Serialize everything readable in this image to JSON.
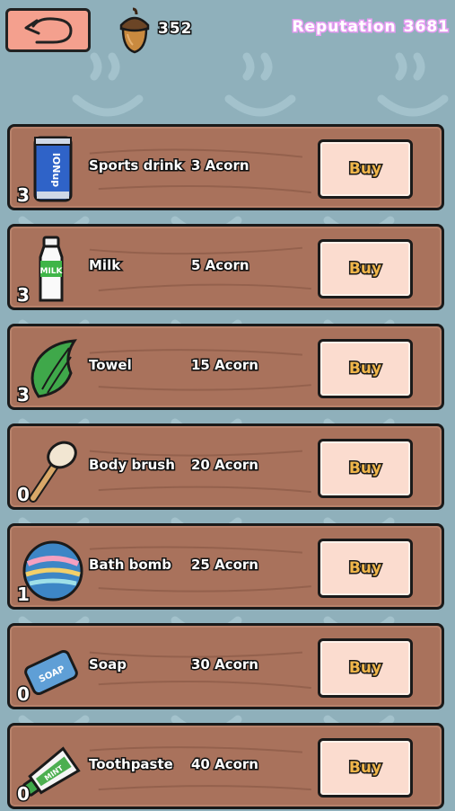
{
  "header": {
    "acorn_count": "352",
    "reputation_label": "Reputation",
    "reputation_value": "3681"
  },
  "items": [
    {
      "name": "Sports drink",
      "price": "3 Acorn",
      "count": "3",
      "buy_label": "Buy",
      "icon": "sports-drink-icon"
    },
    {
      "name": "Milk",
      "price": "5 Acorn",
      "count": "3",
      "buy_label": "Buy",
      "icon": "milk-bottle-icon"
    },
    {
      "name": "Towel",
      "price": "15 Acorn",
      "count": "3",
      "buy_label": "Buy",
      "icon": "towel-icon"
    },
    {
      "name": "Body brush",
      "price": "20 Acorn",
      "count": "0",
      "buy_label": "Buy",
      "icon": "body-brush-icon"
    },
    {
      "name": "Bath bomb",
      "price": "25 Acorn",
      "count": "1",
      "buy_label": "Buy",
      "icon": "bath-bomb-icon"
    },
    {
      "name": "Soap",
      "price": "30 Acorn",
      "count": "0",
      "buy_label": "Buy",
      "icon": "soap-icon"
    },
    {
      "name": "Toothpaste",
      "price": "40 Acorn",
      "count": "0",
      "buy_label": "Buy",
      "icon": "toothpaste-icon"
    }
  ],
  "icon_labels": {
    "sports_drink": "IONup",
    "milk": "MILK",
    "soap": "SOAP",
    "toothpaste": "MINT"
  },
  "colors": {
    "background": "#8fb0bb",
    "wood": "#a9725c",
    "buy_button": "#fbdccf",
    "buy_text": "#f0b64a",
    "reputation_outline": "#e79cf3",
    "back_button": "#f4a08e"
  }
}
